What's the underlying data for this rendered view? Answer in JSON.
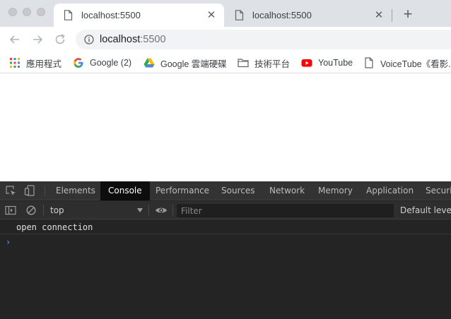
{
  "tabs": [
    {
      "title": "localhost:5500",
      "active": true
    },
    {
      "title": "localhost:5500",
      "active": false
    }
  ],
  "toolbar": {
    "url_host": "localhost",
    "url_port": ":5500"
  },
  "bookmarks": [
    {
      "label": "應用程式",
      "icon": "apps-grid-icon"
    },
    {
      "label": "Google (2)",
      "icon": "google-icon"
    },
    {
      "label": "Google 雲端硬碟",
      "icon": "google-drive-icon"
    },
    {
      "label": "技術平台",
      "icon": "folder-icon"
    },
    {
      "label": "YouTube",
      "icon": "youtube-icon"
    },
    {
      "label": "VoiceTube《看影...",
      "icon": "document-icon"
    }
  ],
  "devtools": {
    "tabs": [
      "Elements",
      "Console",
      "Performance",
      "Sources",
      "Network",
      "Memory",
      "Application",
      "Security"
    ],
    "active_tab": "Console",
    "context": "top",
    "filter_placeholder": "Filter",
    "levels_label": "Default levels",
    "log_message": "open connection",
    "prompt_glyph": "›"
  },
  "colors": {
    "tabstrip": "#dee1e6",
    "devtools_bg": "#242424",
    "devtools_tabbar": "#333333",
    "active_devtools_tab": "#0d0d0d",
    "prompt": "#4c8df6"
  }
}
